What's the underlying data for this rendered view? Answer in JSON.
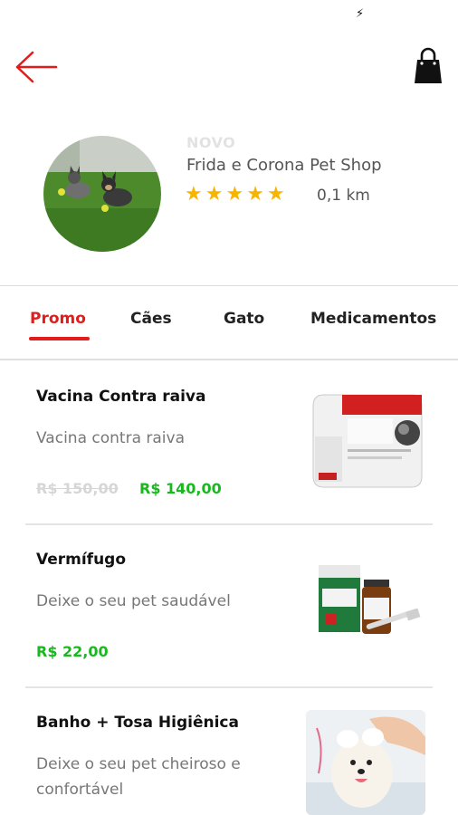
{
  "status_bar": {
    "icons": [
      "lightning-icon"
    ]
  },
  "header": {
    "back_icon": "arrow-left-icon",
    "cart_icon": "shopping-bag-icon"
  },
  "store": {
    "badge": "NOVO",
    "name": "Frida e Corona Pet Shop",
    "rating": 5,
    "distance": "0,1 km",
    "avatar": "store-photo-dogs-on-grass"
  },
  "tabs": [
    {
      "label": "Promo",
      "active": true
    },
    {
      "label": "Cães",
      "active": false
    },
    {
      "label": "Gato",
      "active": false
    },
    {
      "label": "Medicamentos",
      "active": false
    }
  ],
  "products": [
    {
      "title": "Vacina Contra raiva",
      "description": "Vacina contra raiva",
      "old_price": "R$ 150,00",
      "price": "R$ 140,00",
      "image": "rabies-vaccine-box"
    },
    {
      "title": "Vermífugo",
      "description": "Deixe o seu pet saudável",
      "old_price": "",
      "price": "R$ 22,00",
      "image": "dewormer-box-syringe"
    },
    {
      "title": "Banho + Tosa Higiênica",
      "description": "Deixe o seu pet cheiroso e confortável",
      "old_price": "",
      "price": "",
      "image": "dog-bath-photo"
    }
  ],
  "colors": {
    "accent": "#e21b1b",
    "price_green": "#18b81e",
    "star": "#f7b500"
  }
}
